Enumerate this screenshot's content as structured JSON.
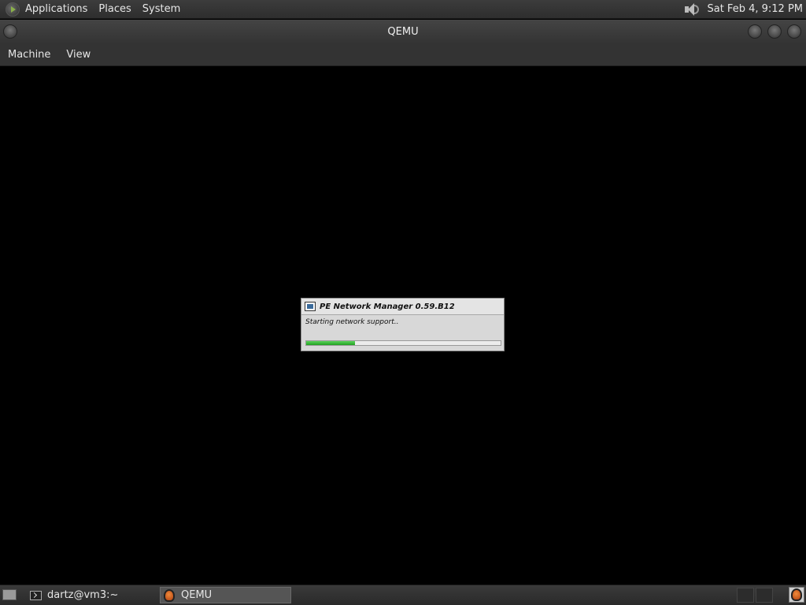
{
  "top_panel": {
    "menus": [
      "Applications",
      "Places",
      "System"
    ],
    "clock": "Sat Feb  4,  9:12 PM",
    "icons": {
      "menu_logo": "distro-logo-icon",
      "volume": "speaker-icon"
    }
  },
  "window": {
    "title": "QEMU",
    "menus": [
      "Machine",
      "View"
    ]
  },
  "dialog": {
    "title": "PE Network Manager 0.59.B12",
    "status": "Starting network support..",
    "progress": 0.25,
    "progress_color": "#3cbc3c"
  },
  "taskbar": {
    "tasks": [
      {
        "label": "dartz@vm3:~",
        "icon": "terminal-icon",
        "active": false
      },
      {
        "label": "QEMU",
        "icon": "qemu-icon",
        "active": true
      }
    ]
  }
}
